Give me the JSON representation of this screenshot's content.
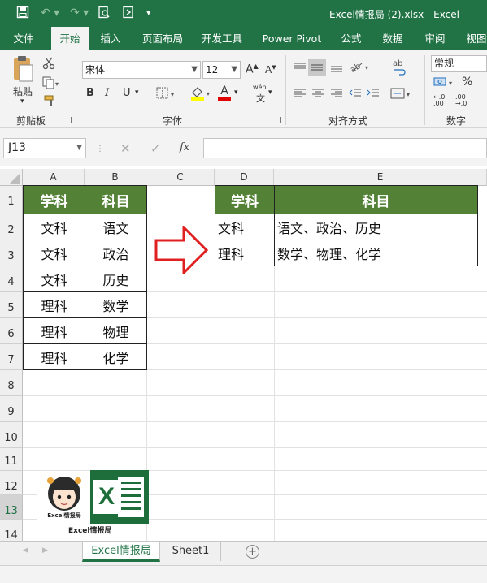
{
  "titlebar": {
    "title": "Excel情报局 (2).xlsx  -  Excel"
  },
  "tabs": [
    "文件",
    "开始",
    "插入",
    "页面布局",
    "开发工具",
    "Power Pivot",
    "公式",
    "数据",
    "审阅",
    "视图"
  ],
  "ribbon": {
    "clipboard": {
      "paste": "粘贴",
      "label": "剪贴板"
    },
    "font": {
      "name": "宋体",
      "size": "12",
      "label": "字体",
      "bold": "B",
      "italic": "I",
      "underline": "U",
      "font_color_glyph": "A",
      "phonetic": "wén"
    },
    "alignment": {
      "label": "对齐方式"
    },
    "number": {
      "format": "常规",
      "label": "数字",
      "percent": "%"
    }
  },
  "formula": {
    "namebox": "J13",
    "fx": "fx",
    "cancel": "✕",
    "enter": "✓",
    "content": ""
  },
  "sheet": {
    "columns": [
      "A",
      "B",
      "C",
      "D",
      "E"
    ],
    "rows": [
      "1",
      "2",
      "3",
      "4",
      "5",
      "6",
      "7",
      "8",
      "9",
      "10",
      "11",
      "12",
      "13",
      "14"
    ],
    "table1": {
      "headers": [
        "学科",
        "科目"
      ],
      "rows": [
        [
          "文科",
          "语文"
        ],
        [
          "文科",
          "政治"
        ],
        [
          "文科",
          "历史"
        ],
        [
          "理科",
          "数学"
        ],
        [
          "理科",
          "物理"
        ],
        [
          "理科",
          "化学"
        ]
      ]
    },
    "table2": {
      "headers": [
        "学科",
        "科目"
      ],
      "rows": [
        [
          "文科",
          "语文、政治、历史"
        ],
        [
          "理科",
          "数学、物理、化学"
        ]
      ]
    },
    "logo": {
      "caption": "Excel情报局",
      "small": "Excel情报局",
      "xl": "X"
    }
  },
  "sheettabs": {
    "tabs": [
      "Excel情报局",
      "Sheet1"
    ],
    "add": "+"
  }
}
